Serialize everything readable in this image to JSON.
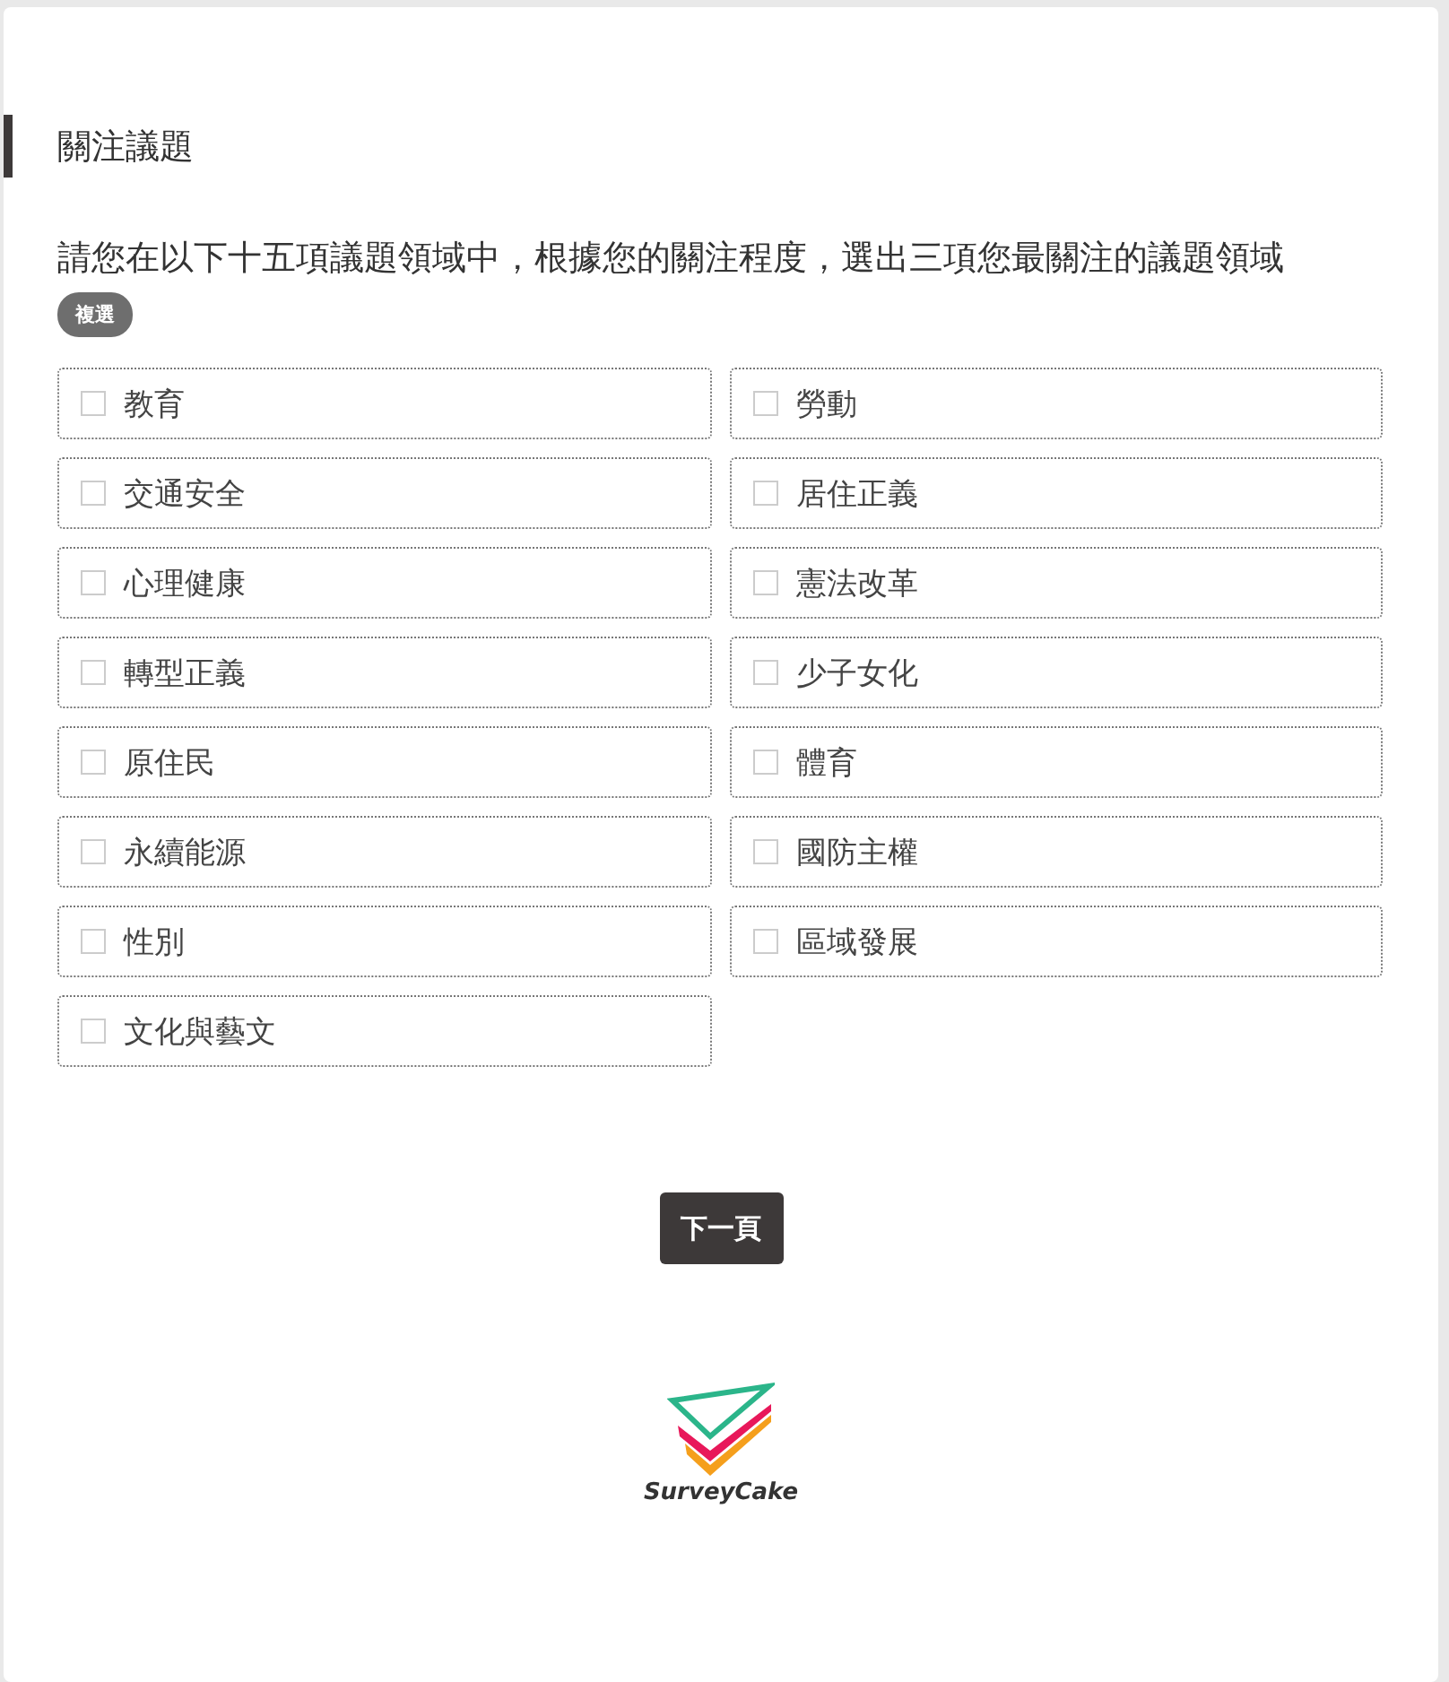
{
  "section": {
    "title": "關注議題"
  },
  "question": {
    "text": "請您在以下十五項議題領域中，根據您的關注程度，選出三項您最關注的議題領域",
    "badge": "複選"
  },
  "options": [
    {
      "label": "教育",
      "checked": false
    },
    {
      "label": "勞動",
      "checked": false
    },
    {
      "label": "交通安全",
      "checked": false
    },
    {
      "label": "居住正義",
      "checked": false
    },
    {
      "label": "心理健康",
      "checked": false
    },
    {
      "label": "憲法改革",
      "checked": false
    },
    {
      "label": "轉型正義",
      "checked": false
    },
    {
      "label": "少子女化",
      "checked": false
    },
    {
      "label": "原住民",
      "checked": false
    },
    {
      "label": "體育",
      "checked": false
    },
    {
      "label": "永續能源",
      "checked": false
    },
    {
      "label": "國防主權",
      "checked": false
    },
    {
      "label": "性別",
      "checked": false
    },
    {
      "label": "區域發展",
      "checked": false
    },
    {
      "label": "文化與藝文",
      "checked": false
    }
  ],
  "next_button": "下一頁",
  "footer": {
    "brand": "SurveyCake"
  }
}
